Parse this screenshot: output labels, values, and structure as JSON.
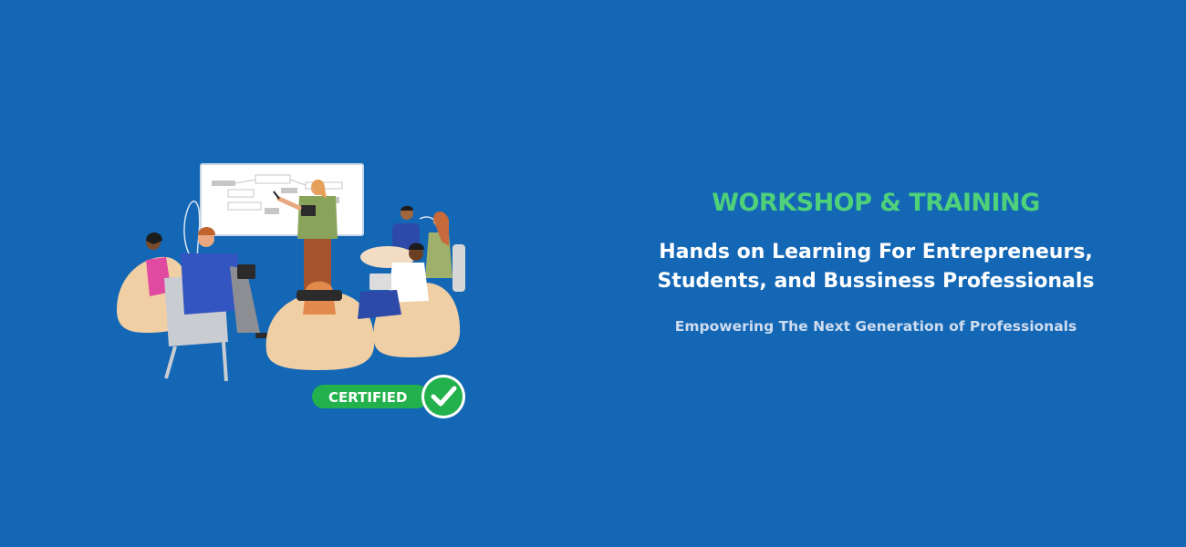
{
  "badge": {
    "label": "CERTIFIED",
    "icon": "checkmark-icon",
    "color": "#22b14c"
  },
  "text": {
    "kicker": "WORKSHOP & TRAINING",
    "headline_line1": "Hands on Learning For Entrepreneurs,",
    "headline_line2": "Students, and Bussiness Professionals",
    "subline": "Empowering The Next Generation of Professionals"
  },
  "colors": {
    "background": "#1367b5",
    "kicker": "#4fd07a",
    "headline": "#ffffff",
    "subline": "#cfdcf0"
  }
}
